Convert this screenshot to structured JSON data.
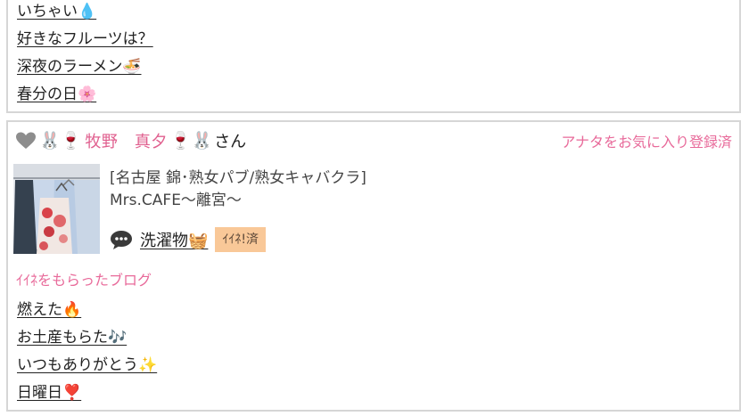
{
  "top_blogs": [
    {
      "title": "いちゃい💧"
    },
    {
      "title": "好きなフルーツは？"
    },
    {
      "title": "深夜のラーメン🍜"
    },
    {
      "title": "春分の日🌸"
    }
  ],
  "user_card": {
    "heart_icon": "heart-gray-icon",
    "prefix_emoji": "🐰🍷",
    "name": "牧野　真夕",
    "suffix_emoji": "🍷🐰",
    "honorific": "さん",
    "favorite_status": "アナタをお気に入り登録済",
    "shop_category": "[名古屋 錦･熟女パブ/熟女キャバクラ]",
    "shop_name": "Mrs.CAFE〜離宮〜",
    "blog_icon": "speech-bubble-icon",
    "blog_title": "洗濯物🧺",
    "iine_badge": "ｲｲﾈ!済",
    "colors": {
      "accent_pink": "#e86a9a",
      "badge_bg": "#f9c898",
      "border": "#d6d6d6"
    }
  },
  "liked_section": {
    "heading": "ｲｲﾈをもらったブログ",
    "blogs": [
      {
        "title": "燃えた🔥"
      },
      {
        "title": "お土産もらた🎶"
      },
      {
        "title": "いつもありがとう✨"
      },
      {
        "title": "日曜日❣️"
      }
    ]
  }
}
